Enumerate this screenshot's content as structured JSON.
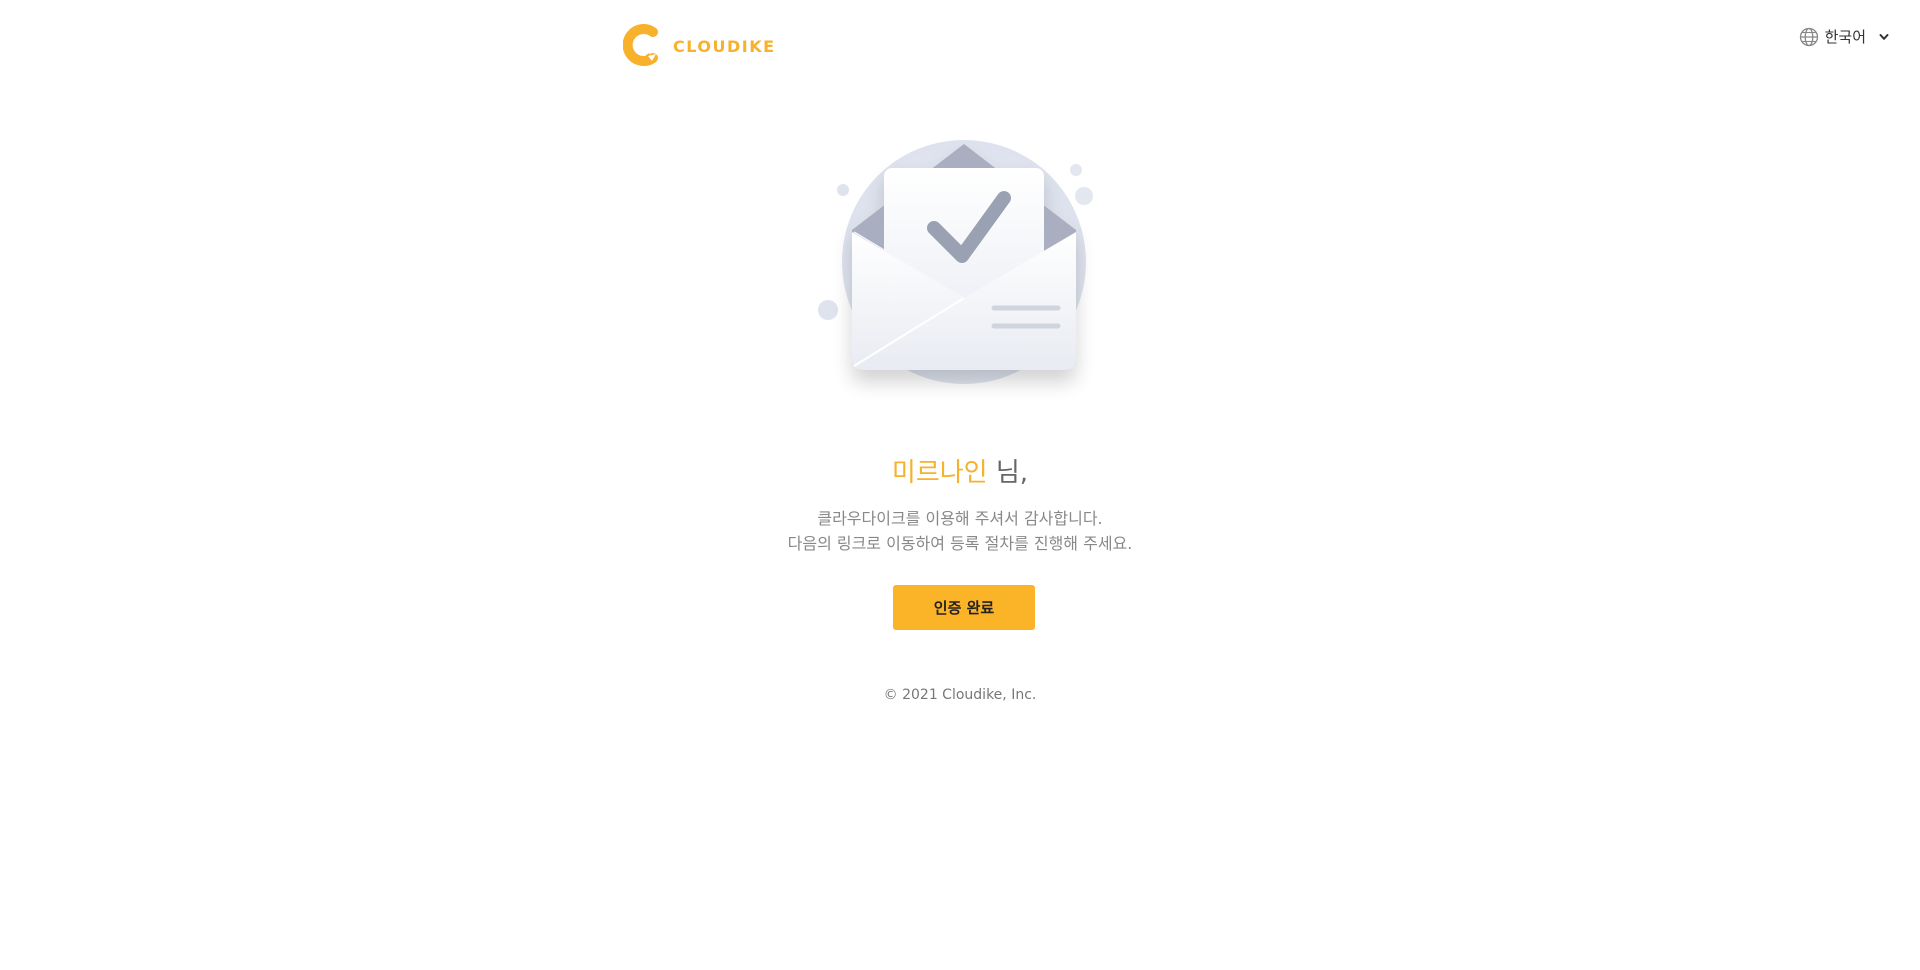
{
  "header": {
    "logo_text": "CLOUDIKE",
    "language": {
      "label": "한국어",
      "globe_icon": "globe-icon",
      "chevron_icon": "chevron-down-icon"
    }
  },
  "illustration": {
    "icon": "envelope-check-icon"
  },
  "greeting": {
    "username": "미르나인",
    "suffix": " 님,"
  },
  "message": {
    "line1": "클라우다이크를 이용해 주셔서 감사합니다.",
    "line2": "다음의 링크로 이동하여 등록 절차를 진행해 주세요."
  },
  "actions": {
    "confirm_label": "인증 완료"
  },
  "footer": {
    "copyright": "© 2021 Cloudike, Inc."
  },
  "colors": {
    "accent": "#f7b12b",
    "button": "#fbb327",
    "text_muted": "#888888"
  }
}
